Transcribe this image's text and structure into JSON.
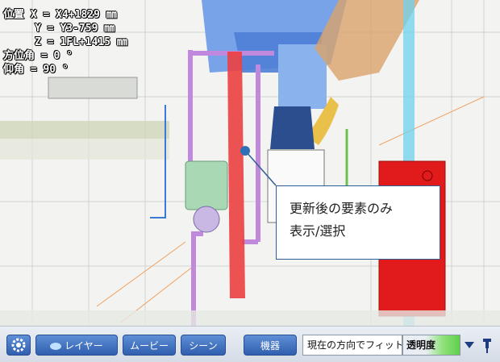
{
  "hud": {
    "x_line": "位置 X = X4+1829 ㎜",
    "y_line": "     Y = Y3-759 ㎜",
    "z_line": "     Z = 1FL+1415 ㎜",
    "azimuth_line": "方位角 = 0 °",
    "elevation_line": "仰角 = 90 °"
  },
  "callout": {
    "line1": "更新後の要素のみ",
    "line2": "表示/選択"
  },
  "toolbar": {
    "layer_label": "レイヤー",
    "movie_label": "ムービー",
    "scene_label": "シーン",
    "equipment_label": "機器",
    "fit_label": "現在の方向でフィット",
    "transparency_label": "透明度"
  },
  "icons": {
    "settings": "gear-icon",
    "layer": "layer-icon",
    "dropdown": "chevron-down-icon",
    "pin": "pin-icon"
  },
  "colors": {
    "button_blue": "#3b6cc0",
    "callout_dot": "#2f6fb7",
    "red_duct": "#e33b3b",
    "red_cabinet": "#e41a1a"
  }
}
